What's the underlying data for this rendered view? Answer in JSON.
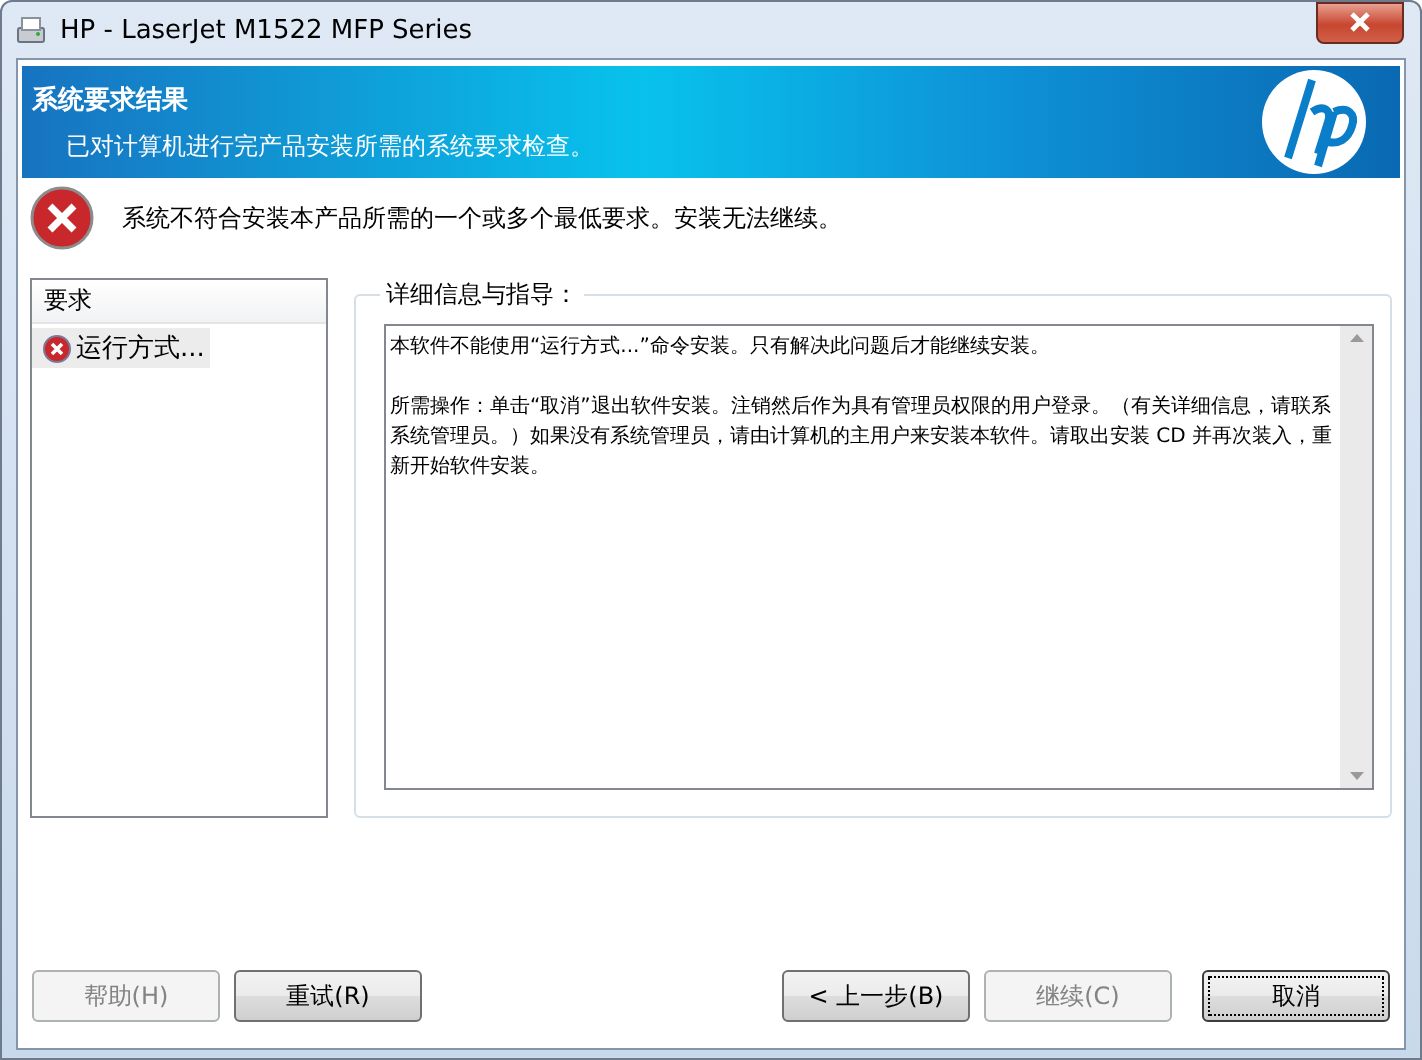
{
  "window": {
    "title": "HP - LaserJet M1522 MFP Series"
  },
  "banner": {
    "title": "系统要求结果",
    "subtitle": "已对计算机进行完产品安装所需的系统要求检查。"
  },
  "error": {
    "message": "系统不符合安装本产品所需的一个或多个最低要求。安装无法继续。"
  },
  "requirements": {
    "header": "要求",
    "items": [
      {
        "label": "运行方式...",
        "selected": true
      }
    ]
  },
  "details": {
    "title": "详细信息与指导：",
    "paragraphs": [
      "本软件不能使用“运行方式...”命令安装。只有解决此问题后才能继续安装。",
      "所需操作：单击“取消”退出软件安装。注销然后作为具有管理员权限的用户登录。（有关详细信息，请联系系统管理员。）如果没有系统管理员，请由计算机的主用户来安装本软件。请取出安装 CD 并再次装入，重新开始软件安装。"
    ]
  },
  "buttons": [
    {
      "label": "帮助(H)",
      "disabled": true,
      "default": false
    },
    {
      "label": "重试(R)",
      "disabled": false,
      "default": false
    },
    {
      "label": "< 上一步(B)",
      "disabled": false,
      "default": false
    },
    {
      "label": "继续(C)",
      "disabled": true,
      "default": false
    },
    {
      "label": "取消",
      "disabled": false,
      "default": true
    }
  ]
}
